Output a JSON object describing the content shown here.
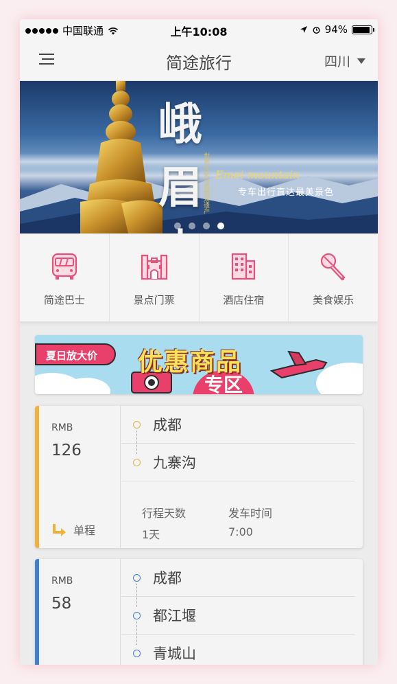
{
  "status": {
    "carrier": "中国联通",
    "time": "上午10:08",
    "battery": "94%",
    "battery_level": 0.94
  },
  "nav": {
    "title": "简途旅行",
    "region": "四川"
  },
  "banner": {
    "calligraphy": "峨眉山",
    "vertical_text": "世界文化与自然双遗产",
    "english": "Emei mountain",
    "subtitle": "专车出行直达最美景色",
    "slide_count": 4,
    "active_slide": 4
  },
  "categories": [
    {
      "label": "简途巴士",
      "icon": "bus-icon"
    },
    {
      "label": "景点门票",
      "icon": "ticket-building-icon"
    },
    {
      "label": "酒店住宿",
      "icon": "hotel-icon"
    },
    {
      "label": "美食娱乐",
      "icon": "microphone-icon"
    }
  ],
  "promo": {
    "tag": "夏日放大价",
    "title": "优惠商品",
    "subtitle": "专区"
  },
  "tickets": [
    {
      "currency": "RMB",
      "price": "126",
      "stripe_color": "#f0b23c",
      "ring_color": "#e0b24a",
      "stops": [
        "成都",
        "九寨沟"
      ],
      "trip_type": "单程",
      "days_label": "行程天数",
      "days": "1天",
      "depart_label": "发车时间",
      "depart": "7:00"
    },
    {
      "currency": "RMB",
      "price": "58",
      "stripe_color": "#3f7fd0",
      "ring_color": "#3f7fd0",
      "stops": [
        "成都",
        "都江堰",
        "青城山"
      ]
    }
  ]
}
